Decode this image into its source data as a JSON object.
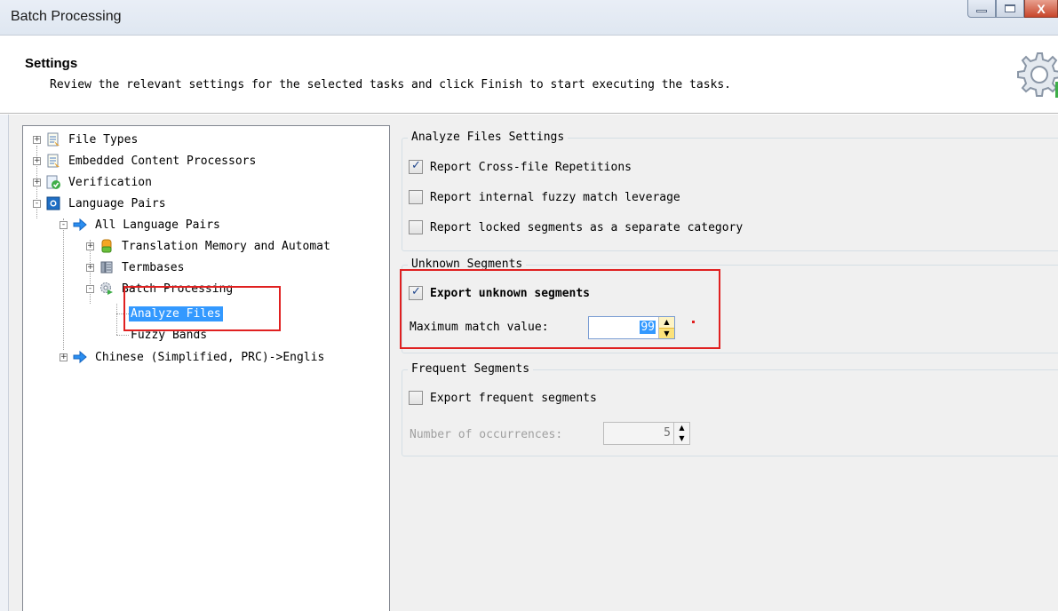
{
  "window": {
    "title": "Batch Processing",
    "close_glyph": "X"
  },
  "header": {
    "title": "Settings",
    "description": "Review the relevant settings for the selected tasks and click Finish to start executing the tasks."
  },
  "tree": {
    "items": [
      {
        "label": "File Types",
        "expander": "+",
        "icon": "file-types-icon"
      },
      {
        "label": "Embedded Content Processors",
        "expander": "+",
        "icon": "embedded-content-icon"
      },
      {
        "label": "Verification",
        "expander": "+",
        "icon": "verification-icon"
      },
      {
        "label": "Language Pairs",
        "expander": "-",
        "icon": "language-pairs-icon"
      },
      {
        "label": "All Language Pairs",
        "expander": "-",
        "icon": "arrow-right-icon"
      },
      {
        "label": "Translation Memory and Automat",
        "expander": "+",
        "icon": "database-icon"
      },
      {
        "label": "Termbases",
        "expander": "+",
        "icon": "termbase-icon"
      },
      {
        "label": "Batch Processing",
        "expander": "-",
        "icon": "gear-play-icon"
      },
      {
        "label": "Analyze Files",
        "selected": true
      },
      {
        "label": "Fuzzy Bands"
      },
      {
        "label": "Chinese (Simplified, PRC)->Englis",
        "expander": "+",
        "icon": "arrow-right-icon"
      }
    ]
  },
  "settings": {
    "analyze": {
      "legend": "Analyze Files Settings",
      "report_cross_file": {
        "label": "Report Cross-file Repetitions",
        "checked": true
      },
      "report_internal_fuzzy": {
        "label": "Report internal fuzzy match leverage",
        "checked": false
      },
      "report_locked": {
        "label": "Report locked segments as a separate category",
        "checked": false
      }
    },
    "unknown": {
      "legend": "Unknown Segments",
      "export_unknown": {
        "label": "Export unknown segments",
        "checked": true
      },
      "max_match_label": "Maximum match value:",
      "max_match_value": "99"
    },
    "frequent": {
      "legend": "Frequent Segments",
      "export_frequent": {
        "label": "Export frequent segments",
        "checked": false
      },
      "occurrences_label": "Number of occurrences:",
      "occurrences_value": "5"
    }
  },
  "colors": {
    "highlight": "#3399ff",
    "annotation": "#e02020"
  }
}
